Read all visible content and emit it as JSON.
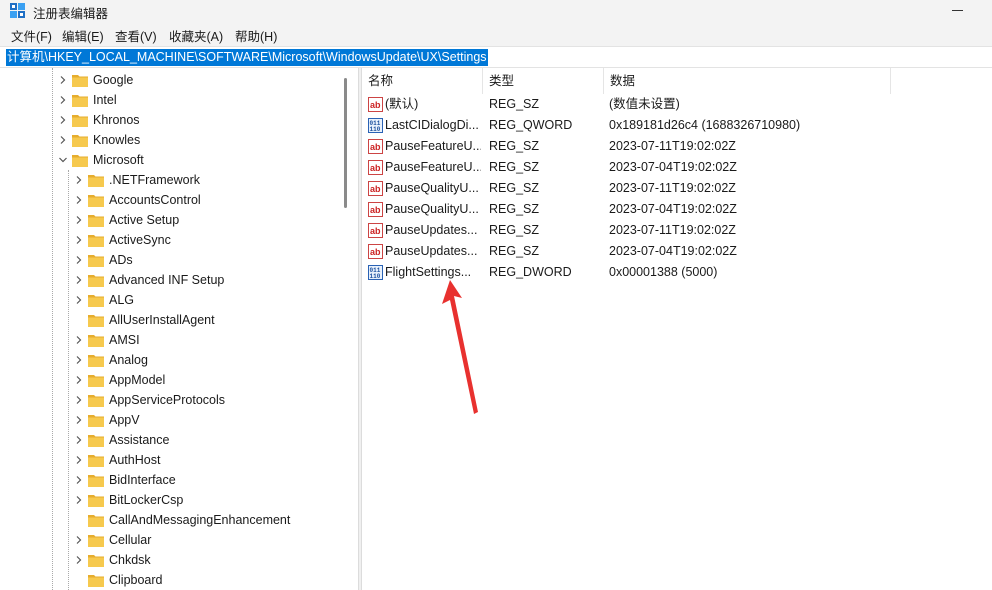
{
  "window": {
    "title": "注册表编辑器"
  },
  "menu": [
    "文件(F)",
    "编辑(E)",
    "查看(V)",
    "收藏夹(A)",
    "帮助(H)"
  ],
  "address": {
    "path": "计算机\\HKEY_LOCAL_MACHINE\\SOFTWARE\\Microsoft\\WindowsUpdate\\UX\\Settings"
  },
  "tree": {
    "top_items": [
      {
        "label": "Google",
        "expanded": false
      },
      {
        "label": "Intel",
        "expanded": false
      },
      {
        "label": "Khronos",
        "expanded": false
      },
      {
        "label": "Knowles",
        "expanded": false
      },
      {
        "label": "Microsoft",
        "expanded": true
      }
    ],
    "children": [
      {
        "label": ".NETFramework",
        "has_children": true
      },
      {
        "label": "AccountsControl",
        "has_children": true
      },
      {
        "label": "Active Setup",
        "has_children": true
      },
      {
        "label": "ActiveSync",
        "has_children": true
      },
      {
        "label": "ADs",
        "has_children": true
      },
      {
        "label": "Advanced INF Setup",
        "has_children": true
      },
      {
        "label": "ALG",
        "has_children": true
      },
      {
        "label": "AllUserInstallAgent",
        "has_children": false
      },
      {
        "label": "AMSI",
        "has_children": true
      },
      {
        "label": "Analog",
        "has_children": true
      },
      {
        "label": "AppModel",
        "has_children": true
      },
      {
        "label": "AppServiceProtocols",
        "has_children": true
      },
      {
        "label": "AppV",
        "has_children": true
      },
      {
        "label": "Assistance",
        "has_children": true
      },
      {
        "label": "AuthHost",
        "has_children": true
      },
      {
        "label": "BidInterface",
        "has_children": true
      },
      {
        "label": "BitLockerCsp",
        "has_children": true
      },
      {
        "label": "CallAndMessagingEnhancement",
        "has_children": false
      },
      {
        "label": "Cellular",
        "has_children": true
      },
      {
        "label": "Chkdsk",
        "has_children": true
      },
      {
        "label": "Clipboard",
        "has_children": false
      }
    ]
  },
  "list": {
    "headers": {
      "name": "名称",
      "type": "类型",
      "data": "数据"
    },
    "rows": [
      {
        "name": "(默认)",
        "type": "REG_SZ",
        "data": "(数值未设置)",
        "icon": "string-value-icon"
      },
      {
        "name": "LastCIDialogDi...",
        "type": "REG_QWORD",
        "data": "0x189181d26c4 (1688326710980)",
        "icon": "binary-value-icon"
      },
      {
        "name": "PauseFeatureU...",
        "type": "REG_SZ",
        "data": "2023-07-11T19:02:02Z",
        "icon": "string-value-icon"
      },
      {
        "name": "PauseFeatureU...",
        "type": "REG_SZ",
        "data": "2023-07-04T19:02:02Z",
        "icon": "string-value-icon"
      },
      {
        "name": "PauseQualityU...",
        "type": "REG_SZ",
        "data": "2023-07-11T19:02:02Z",
        "icon": "string-value-icon"
      },
      {
        "name": "PauseQualityU...",
        "type": "REG_SZ",
        "data": "2023-07-04T19:02:02Z",
        "icon": "string-value-icon"
      },
      {
        "name": "PauseUpdates...",
        "type": "REG_SZ",
        "data": "2023-07-11T19:02:02Z",
        "icon": "string-value-icon"
      },
      {
        "name": "PauseUpdates...",
        "type": "REG_SZ",
        "data": "2023-07-04T19:02:02Z",
        "icon": "string-value-icon"
      },
      {
        "name": "FlightSettings...",
        "type": "REG_DWORD",
        "data": "0x00001388 (5000)",
        "icon": "binary-value-icon"
      }
    ]
  },
  "colors": {
    "selection": "#0078d7",
    "folder": "#f6c94e",
    "annotation_arrow": "#e8312f"
  }
}
